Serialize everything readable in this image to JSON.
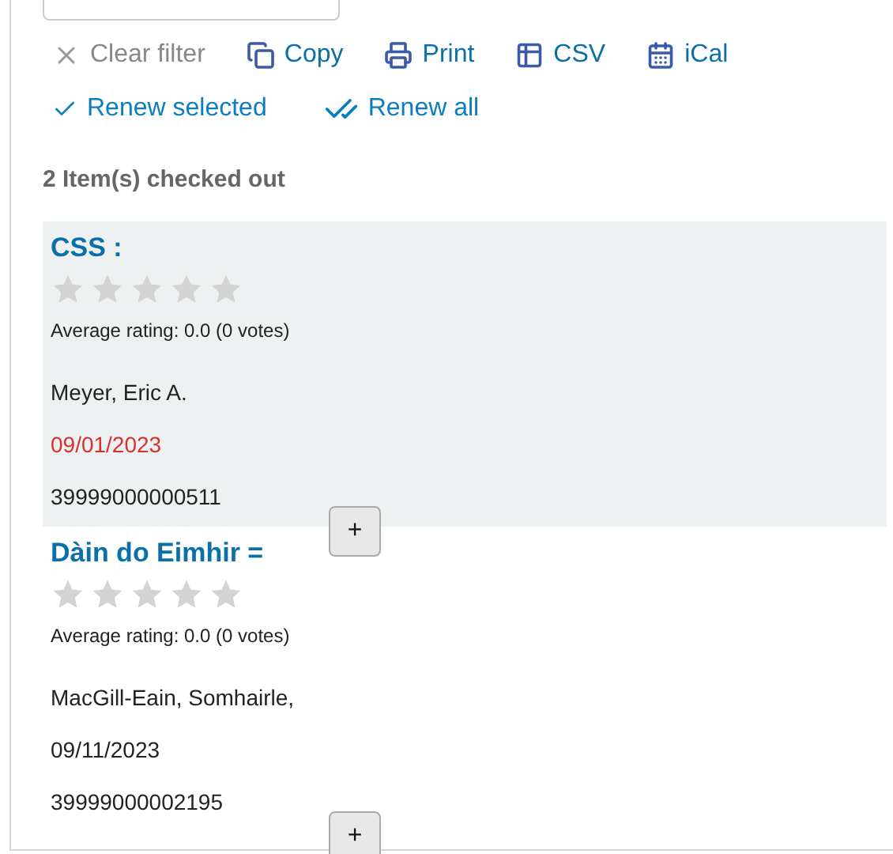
{
  "toolbar": [
    {
      "kind": "clear",
      "label": "Clear filter",
      "disabled": true
    },
    {
      "kind": "copy",
      "label": "Copy",
      "disabled": false
    },
    {
      "kind": "print",
      "label": "Print",
      "disabled": false
    },
    {
      "kind": "csv",
      "label": "CSV",
      "disabled": false
    },
    {
      "kind": "ical",
      "label": "iCal",
      "disabled": false
    }
  ],
  "renew_actions": [
    {
      "kind": "selected",
      "label": "Renew selected"
    },
    {
      "kind": "all",
      "label": "Renew all"
    }
  ],
  "heading": "2 Item(s) checked out",
  "items": [
    {
      "title": "CSS :",
      "stars": 0,
      "rating": "Average rating: 0.0 (0 votes)",
      "author": "Meyer, Eric A.",
      "due_date": "09/01/2023",
      "overdue": true,
      "barcode": "39999000000511",
      "highlighted": true,
      "expand_label": "+"
    },
    {
      "title": "Dàin do Eimhir =",
      "stars": 0,
      "rating": "Average rating: 0.0 (0 votes)",
      "author": "MacGill-Eain, Somhairle,",
      "due_date": "09/11/2023",
      "overdue": false,
      "barcode": "39999000002195",
      "highlighted": false,
      "expand_label": "+"
    }
  ]
}
